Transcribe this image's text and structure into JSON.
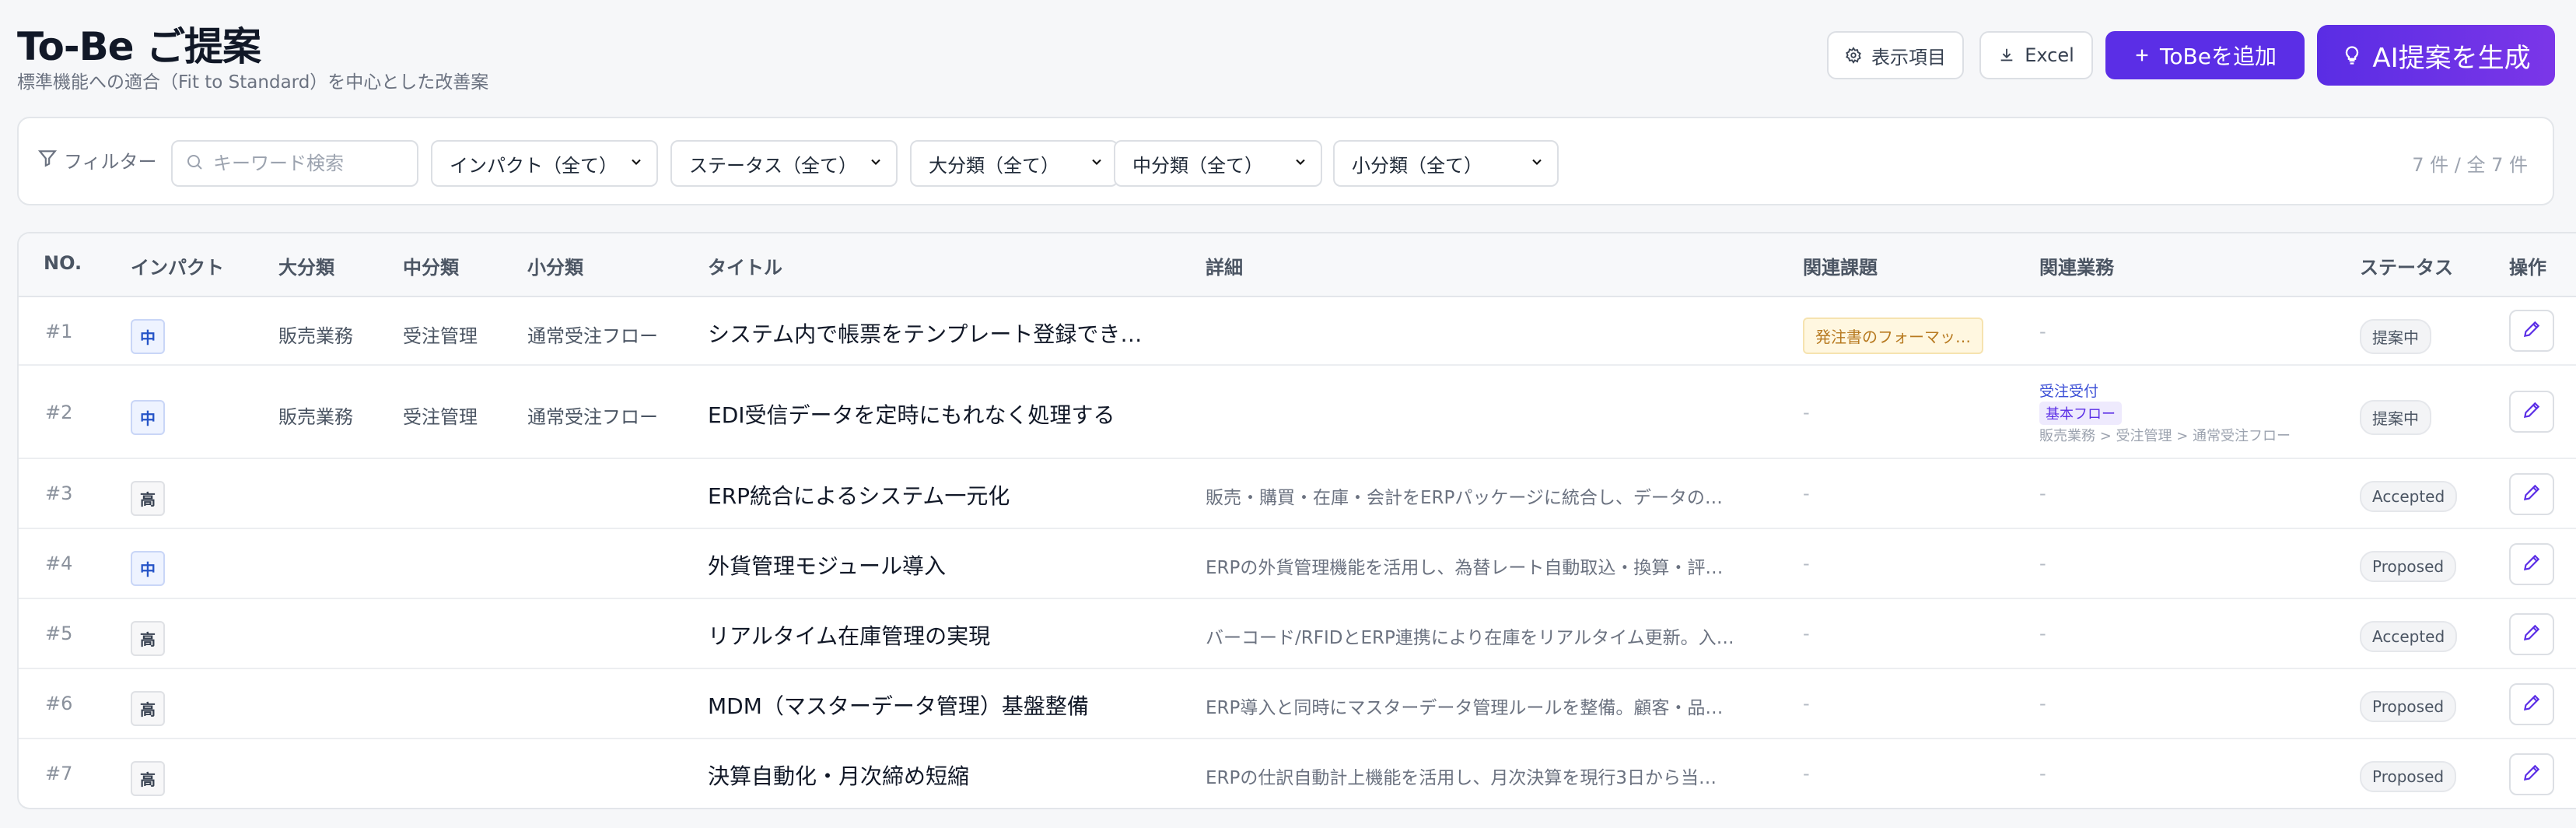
{
  "header": {
    "title": "To-Be ご提案",
    "subtitle": "標準機能への適合（Fit to Standard）を中心とした改善案",
    "buttons": {
      "display_items": "表示項目",
      "excel": "Excel",
      "add_tobe": "ToBeを追加",
      "ai_generate": "AI提案を生成"
    }
  },
  "filters": {
    "label": "フィルター",
    "search_placeholder": "キーワード検索",
    "selects": {
      "impact": "インパクト（全て）",
      "status": "ステータス（全て）",
      "major": "大分類（全て）",
      "middle": "中分類（全て）",
      "minor": "小分類（全て）"
    },
    "count": "7 件 / 全 7 件"
  },
  "table": {
    "columns": {
      "no": "NO.",
      "impact": "インパクト",
      "major": "大分類",
      "middle": "中分類",
      "minor": "小分類",
      "title": "タイトル",
      "detail": "詳細",
      "issue": "関連課題",
      "business": "関連業務",
      "status": "ステータス",
      "action": "操作"
    },
    "dash": "-",
    "rows": [
      {
        "no": "#1",
        "impact": "中",
        "major": "販売業務",
        "middle": "受注管理",
        "minor": "通常受注フロー",
        "title": "システム内で帳票をテンプレート登録でき…",
        "detail": "",
        "issue": "発注書のフォーマッ…",
        "status": "提案中"
      },
      {
        "no": "#2",
        "impact": "中",
        "major": "販売業務",
        "middle": "受注管理",
        "minor": "通常受注フロー",
        "title": "EDI受信データを定時にもれなく処理する",
        "detail": "",
        "issue": "",
        "business": {
          "name": "受注受付",
          "flow": "基本フロー",
          "path": "販売業務 > 受注管理 > 通常受注フロー"
        },
        "status": "提案中"
      },
      {
        "no": "#3",
        "impact": "高",
        "major": "",
        "middle": "",
        "minor": "",
        "title": "ERP統合によるシステム一元化",
        "detail": "販売・購買・在庫・会計をERPパッケージに統合し、データの…",
        "status": "Accepted"
      },
      {
        "no": "#4",
        "impact": "中",
        "major": "",
        "middle": "",
        "minor": "",
        "title": "外貨管理モジュール導入",
        "detail": "ERPの外貨管理機能を活用し、為替レート自動取込・換算・評…",
        "status": "Proposed"
      },
      {
        "no": "#5",
        "impact": "高",
        "major": "",
        "middle": "",
        "minor": "",
        "title": "リアルタイム在庫管理の実現",
        "detail": "バーコード/RFIDとERP連携により在庫をリアルタイム更新。入…",
        "status": "Accepted"
      },
      {
        "no": "#6",
        "impact": "高",
        "major": "",
        "middle": "",
        "minor": "",
        "title": "MDM（マスターデータ管理）基盤整備",
        "detail": "ERP導入と同時にマスターデータ管理ルールを整備。顧客・品…",
        "status": "Proposed"
      },
      {
        "no": "#7",
        "impact": "高",
        "major": "",
        "middle": "",
        "minor": "",
        "title": "決算自動化・月次締め短縮",
        "detail": "ERPの仕訳自動計上機能を活用し、月次決算を現行3日から当…",
        "status": "Proposed"
      }
    ]
  },
  "colors": {
    "accent": "#5b2ee6",
    "impact_mid": "#2554c7",
    "issue_tag": "#b7791f"
  }
}
